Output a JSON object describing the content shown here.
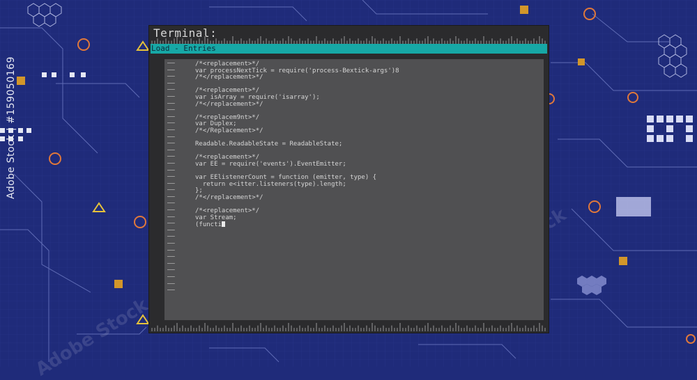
{
  "terminal": {
    "title": "Terminal:",
    "tab_label": "Load - Entries",
    "gutter_marker": "——",
    "code_lines": [
      "/*<replacement>*/",
      "var processNextTick = require('process-Bextick-args')8",
      "/*</replacement>*/",
      "",
      "/*<replacement>*/",
      "var isArray = require('isarray');",
      "/*</replacement>*/",
      "",
      "/*<replacem9nt>*/",
      "var Duplex;",
      "/*</Replacement>*/",
      "",
      "Readable.ReadableState = ReadableState;",
      "",
      "/*<replacement>*/",
      "var EE = require('events').EventEmitter;",
      "",
      "var EElistenerCount = function (emitter, type) {",
      "  return e<itter.listeners(type).length;",
      "};",
      "/*</replacement>*/",
      "",
      "/*<replacement>*/",
      "var Stream;",
      "(functi"
    ],
    "gutter_rows": 35
  },
  "watermark": {
    "side_id": "Adobe Stock | #159050169",
    "stock_text": "Adobe Stock"
  },
  "colors": {
    "background": "#1f2b7a",
    "accent_teal": "#17a8a6",
    "accent_orange": "#e07a3a"
  }
}
